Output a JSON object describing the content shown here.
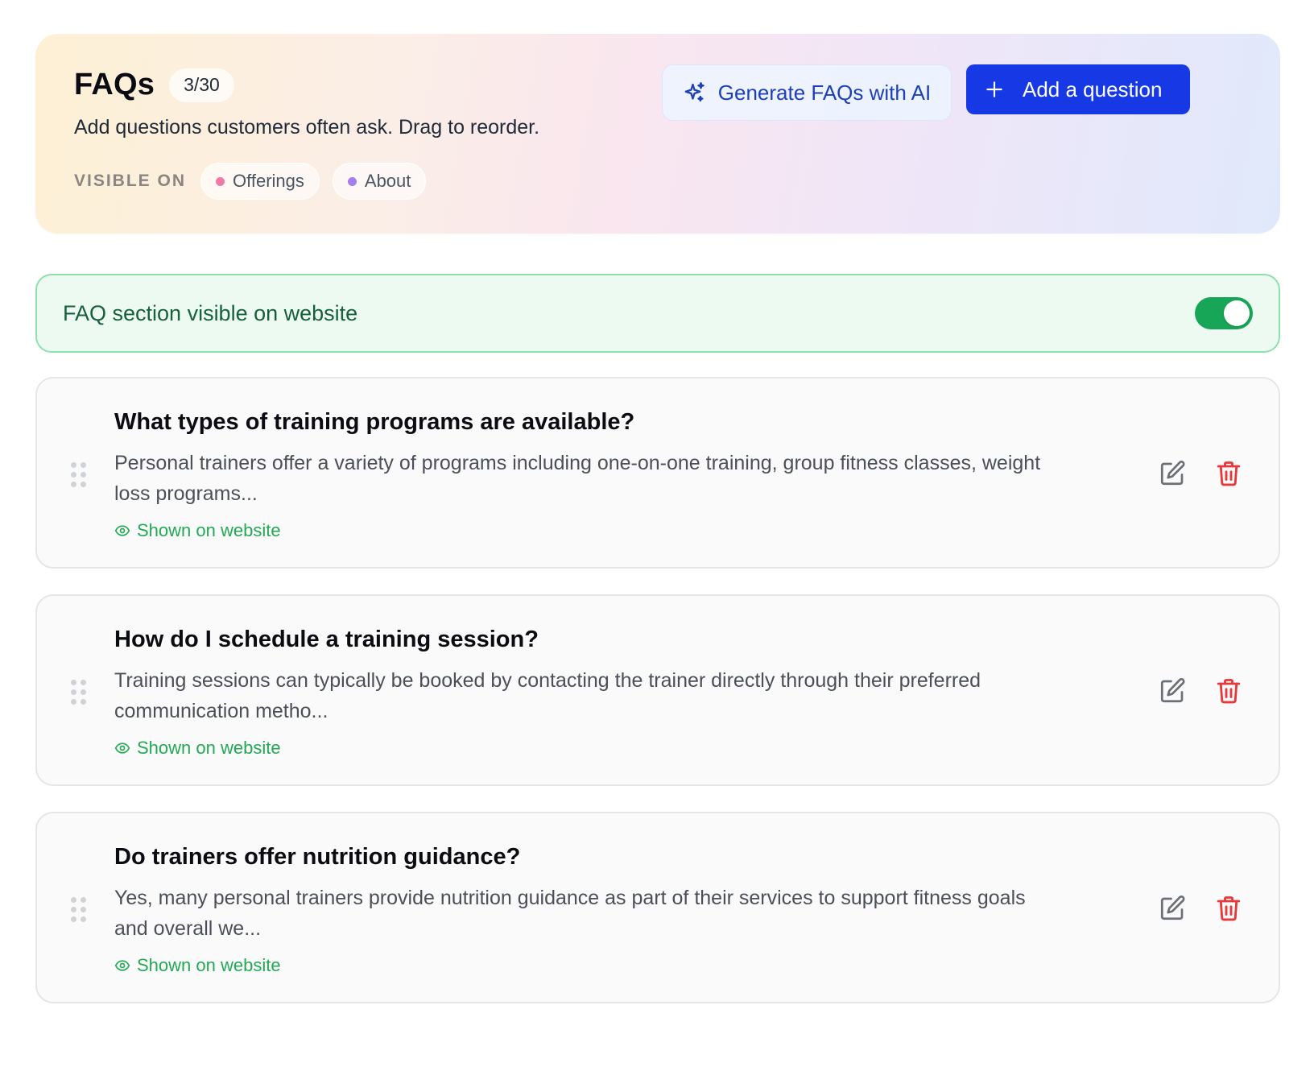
{
  "header": {
    "title": "FAQs",
    "count": "3/30",
    "subtitle": "Add questions customers often ask. Drag to reorder.",
    "visible_on_label": "VISIBLE ON",
    "chips": [
      {
        "label": "Offerings",
        "dot_color": "#f178a8"
      },
      {
        "label": "About",
        "dot_color": "#a47df0"
      }
    ],
    "generate_button": "Generate FAQs with AI",
    "add_button": "Add a question"
  },
  "visibility": {
    "label": "FAQ section visible on website",
    "enabled": true
  },
  "faqs": [
    {
      "question": "What types of training programs are available?",
      "answer": "Personal trainers offer a variety of programs including one-on-one training, group fitness classes, weight loss programs...",
      "status": "Shown on website"
    },
    {
      "question": "How do I schedule a training session?",
      "answer": "Training sessions can typically be booked by contacting the trainer directly through their preferred communication metho...",
      "status": "Shown on website"
    },
    {
      "question": "Do trainers offer nutrition guidance?",
      "answer": "Yes, many personal trainers provide nutrition guidance as part of their services to support fitness goals and overall we...",
      "status": "Shown on website"
    }
  ],
  "colors": {
    "primary": "#1739e5",
    "success": "#22a954",
    "danger": "#e5393b"
  }
}
